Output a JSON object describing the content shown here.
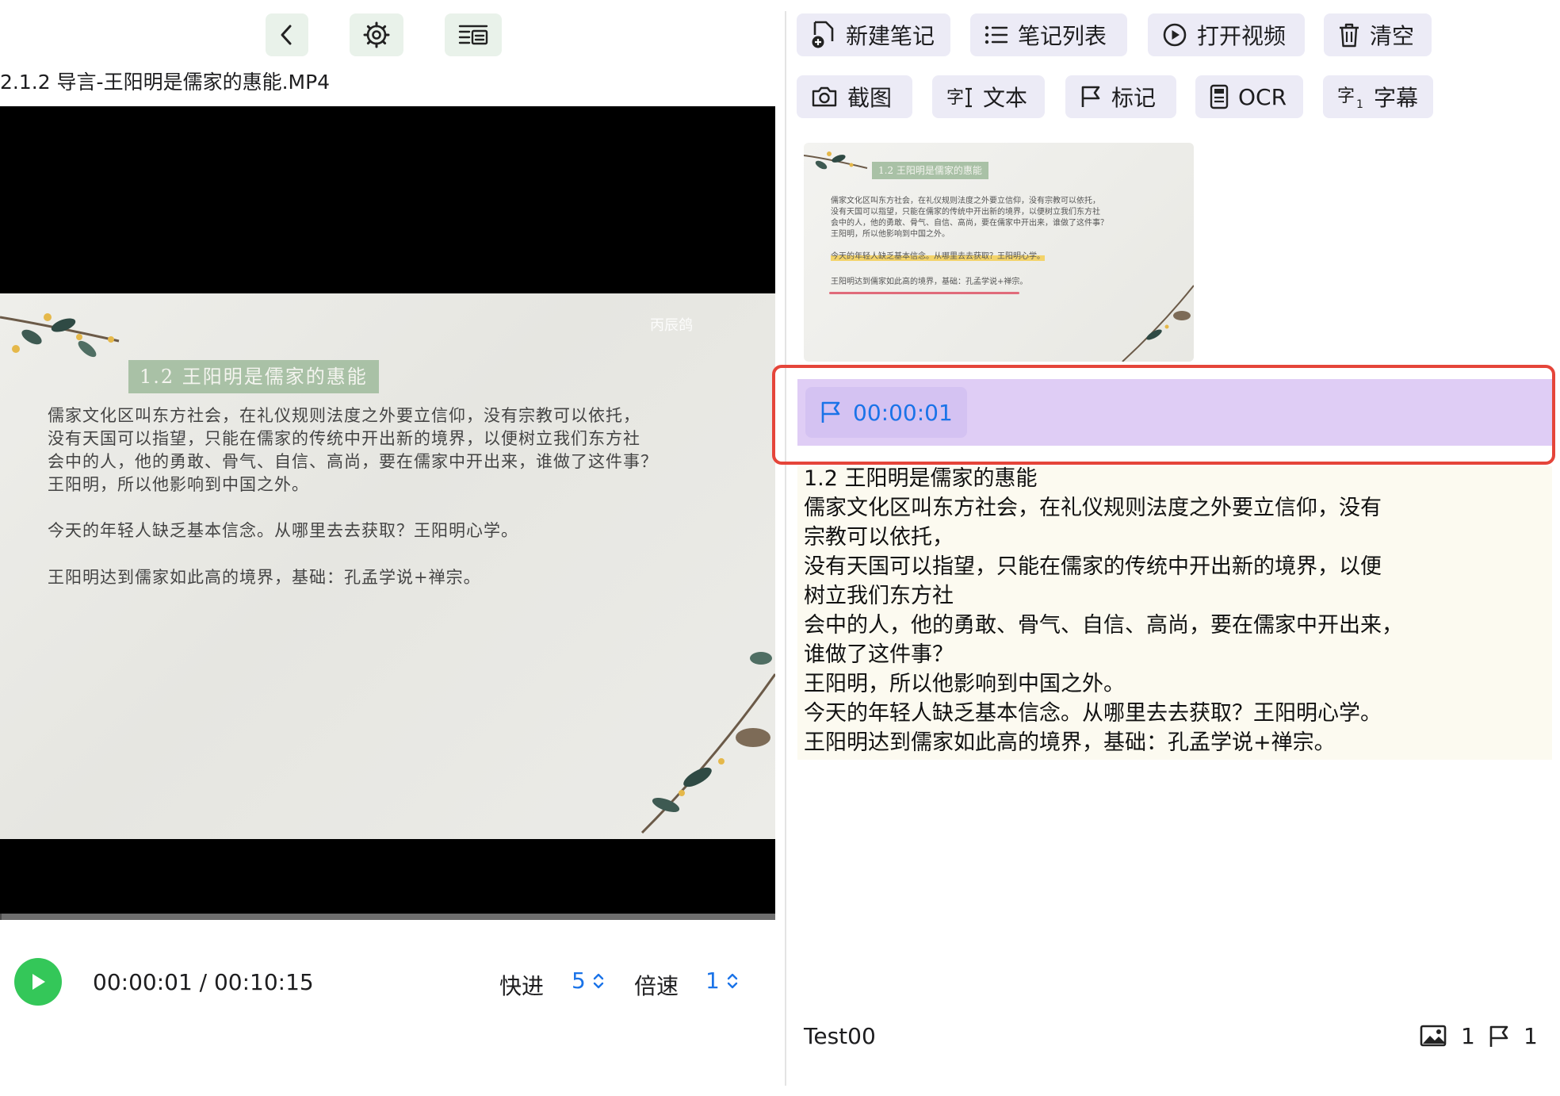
{
  "left": {
    "nav": {
      "back_icon": "chevron-left-icon",
      "settings_icon": "gear-icon",
      "layout_icon": "list-layout-icon"
    },
    "video_title": "2.1.2 导言-王阳明是儒家的惠能.MP4",
    "frame": {
      "heading": "1.2 王阳明是儒家的惠能",
      "watermark": "丙辰鸽",
      "lines": [
        "儒家文化区叫东方社会，在礼仪规则法度之外要立信仰，没有宗教可以依托，",
        "没有天国可以指望，只能在儒家的传统中开出新的境界，以便树立我们东方社",
        "会中的人，他的勇敢、骨气、自信、高尚，要在儒家中开出来，谁做了这件事？",
        "王阳明，所以他影响到中国之外。",
        "今天的年轻人缺乏基本信念。从哪里去去获取？王阳明心学。",
        "王阳明达到儒家如此高的境界，基础：孔孟学说+禅宗。"
      ]
    },
    "progress_fraction": 0.0016,
    "controls": {
      "time": "00:00:01 / 00:10:15",
      "forward_label": "快进",
      "forward_value": "5",
      "speed_label": "倍速",
      "speed_value": "1"
    }
  },
  "right": {
    "toolbar_row1": [
      {
        "label": "新建笔记",
        "icon": "new-note-icon"
      },
      {
        "label": "笔记列表",
        "icon": "list-icon"
      },
      {
        "label": "打开视频",
        "icon": "play-circle-icon"
      },
      {
        "label": "清空",
        "icon": "trash-icon"
      }
    ],
    "toolbar_row2": [
      {
        "label": "截图",
        "icon": "camera-icon"
      },
      {
        "label": "文本",
        "icon": "text-icon"
      },
      {
        "label": "标记",
        "icon": "flag-icon"
      },
      {
        "label": "OCR",
        "icon": "ocr-icon"
      },
      {
        "label": "字幕",
        "icon": "subtitle-icon"
      }
    ],
    "mark": {
      "time": "00:00:01"
    },
    "note_text": [
      "1.2 王阳明是儒家的惠能",
      "儒家文化区叫东方社会，在礼仪规则法度之外要立信仰，没有",
      "宗教可以依托，",
      "没有天国可以指望，只能在儒家的传统中开出新的境界，以便",
      "树立我们东方社",
      "会中的人，他的勇敢、骨气、自信、高尚，要在儒家中开出来，",
      "谁做了这件事？",
      "王阳明，所以他影响到中国之外。",
      "今天的年轻人缺乏基本信念。从哪里去去获取？王阳明心学。",
      "王阳明达到儒家如此高的境界，基础：孔孟学说+禅宗。"
    ],
    "footer": {
      "note_name": "Test00",
      "image_count": "1",
      "mark_count": "1"
    }
  },
  "colors": {
    "accent_blue": "#1a73e8",
    "play_green": "#34c759",
    "highlight_red": "#e5453a",
    "mark_purple": "#dfcdf5"
  }
}
